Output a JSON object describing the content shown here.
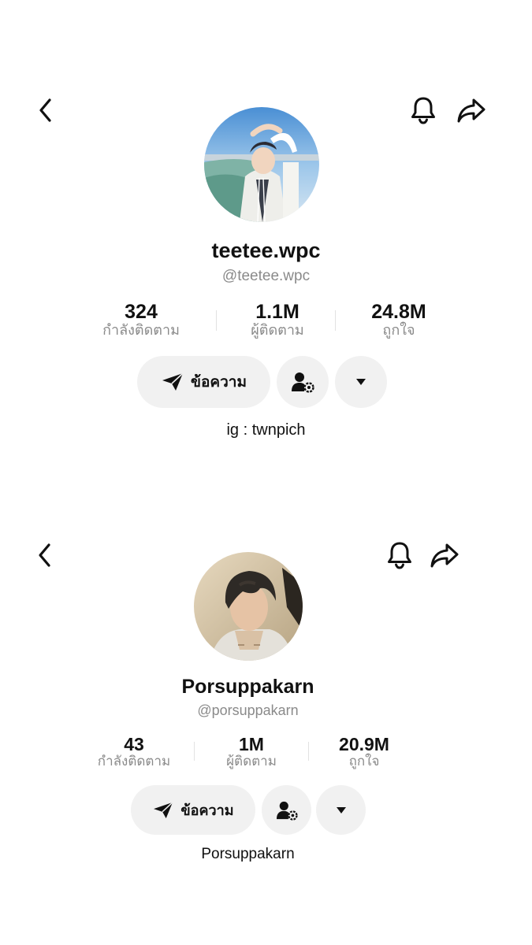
{
  "colors": {
    "background": "#ffffff",
    "button_bg": "#f1f1f1",
    "secondary_text": "#8a8a8a",
    "primary_text": "#111111"
  },
  "icons": {
    "back": "chevron-left-icon",
    "notify": "bell-icon",
    "share": "share-arrow-icon",
    "message": "paper-plane-icon",
    "manage": "person-gear-icon",
    "more": "caret-down-icon"
  },
  "profiles": [
    {
      "display_name": "teetee.wpc",
      "handle": "@teetee.wpc",
      "stats": [
        {
          "value": "324",
          "label": "กำลังติดตาม"
        },
        {
          "value": "1.1M",
          "label": "ผู้ติดตาม"
        },
        {
          "value": "24.8M",
          "label": "ถูกใจ"
        }
      ],
      "message_label": "ข้อความ",
      "bio": "ig : twnpich"
    },
    {
      "display_name": "Porsuppakarn",
      "handle": "@porsuppakarn",
      "stats": [
        {
          "value": "43",
          "label": "กำลังติดตาม"
        },
        {
          "value": "1M",
          "label": "ผู้ติดตาม"
        },
        {
          "value": "20.9M",
          "label": "ถูกใจ"
        }
      ],
      "message_label": "ข้อความ",
      "bio": "Porsuppakarn"
    }
  ]
}
